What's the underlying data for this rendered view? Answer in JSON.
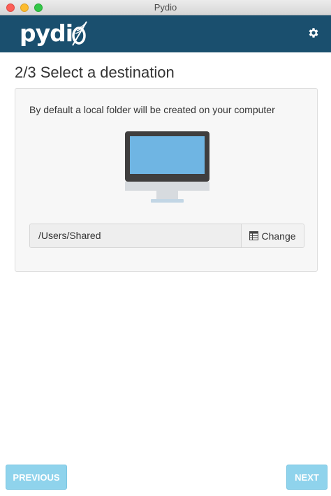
{
  "window": {
    "title": "Pydio"
  },
  "header": {
    "logo_text": "pydi",
    "logo_icon": "feather-icon",
    "settings_icon": "gear-icon",
    "background_color": "#1a4f6e"
  },
  "page": {
    "title": "2/3 Select a destination"
  },
  "panel": {
    "description": "By default a local folder will be created on your computer",
    "illustration": "monitor-icon",
    "destination": {
      "value": "/Users/Shared",
      "change_label": "Change",
      "change_icon": "table-icon"
    }
  },
  "footer": {
    "previous_label": "PREVIOUS",
    "next_label": "NEXT",
    "button_color": "#8fd3ec"
  }
}
